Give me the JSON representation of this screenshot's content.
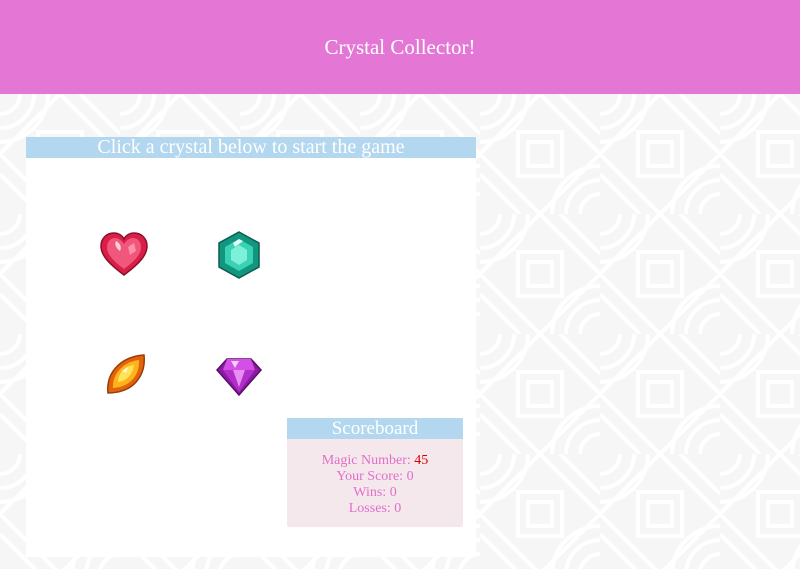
{
  "header": {
    "title": "Crystal Collector!"
  },
  "game": {
    "instruction": "Click a crystal below to start the game",
    "crystals": [
      {
        "name": "heart-crystal",
        "color": "#e8334f"
      },
      {
        "name": "hexagon-crystal",
        "color": "#2ec4a6"
      },
      {
        "name": "leaf-crystal",
        "color": "#f29a16"
      },
      {
        "name": "diamond-crystal",
        "color": "#b02ec9"
      }
    ]
  },
  "scoreboard": {
    "title": "Scoreboard",
    "magic_number_label": "Magic Number: ",
    "magic_number": "45",
    "score_label": "Your Score: ",
    "score": "0",
    "wins_label": "Wins: ",
    "wins": "0",
    "losses_label": "Losses: ",
    "losses": "0"
  },
  "colors": {
    "header_bg": "#e477d5",
    "bar_bg": "#b3d7ef",
    "text_pink": "#e06fc8",
    "magic_red": "#d80000"
  }
}
